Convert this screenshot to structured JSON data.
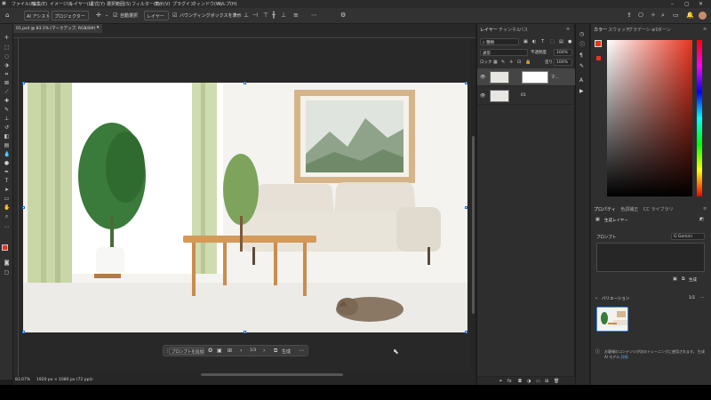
{
  "menubar": {
    "items": [
      "ファイル(F)",
      "編集(E)",
      "イメージ(I)",
      "レイヤー(L)",
      "書式(Y)",
      "選択範囲(S)",
      "フィルター(T)",
      "表示(V)",
      "プラグイン",
      "ウィンドウ(W)",
      "ヘルプ(H)"
    ]
  },
  "options_bar": {
    "ai_assist": "AI アシスト",
    "project": "プロジェクター",
    "auto_select": "自動選択",
    "layer_select": "レイヤー",
    "bounding_box": "バウンディングボックスを表示"
  },
  "document": {
    "tab_title": "01.psd @ 83.1% (マークアップ, RGB/8#) *",
    "zoom": "83.07%",
    "dimensions": "1920 px × 1080 px (72 ppi)"
  },
  "contextual_taskbar": {
    "prompt_placeholder": "プロンプトを追加",
    "page_indicator": "1/3",
    "generate_label": "生成"
  },
  "layers_panel": {
    "tabs": [
      "レイヤー",
      "チャンネル",
      "パス"
    ],
    "search_kind": "種類",
    "blend_mode": "通常",
    "opacity_label": "不透明度",
    "opacity_value": "100%",
    "lock_label": "ロック",
    "fill_label": "塗り",
    "fill_value": "100%",
    "layers": [
      {
        "name": "マ...",
        "selected": true
      },
      {
        "name": "01",
        "selected": false
      }
    ]
  },
  "color_panel": {
    "tabs": [
      "カラー",
      "スウォッチ",
      "グラデーション",
      "パターン"
    ],
    "foreground": "#e8351f"
  },
  "properties_panel": {
    "tabs": [
      "プロパティ",
      "色調補正",
      "CC ライブラリ"
    ],
    "layer_type": "生成レイヤー",
    "prompt_label": "プロンプト",
    "model": "Gemini",
    "generate_label": "生成",
    "variations_label": "バリエーション",
    "variations_count": "1/1",
    "notice": "お客様のコンテンツが次のトレーニングに使用されます。",
    "notice_model": "生成 AI モデル",
    "notice_link": "詳細"
  }
}
